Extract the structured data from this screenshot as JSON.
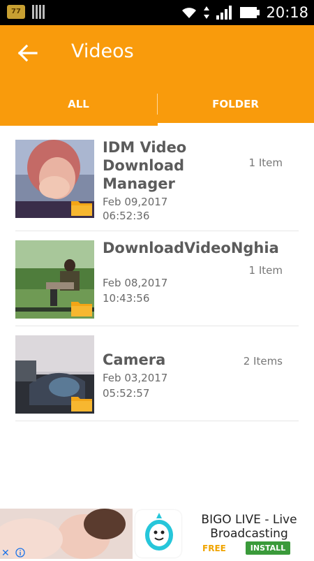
{
  "status_bar": {
    "notification_icon_text": "77",
    "time": "20:18",
    "icons": [
      "sim-icon",
      "wifi-icon",
      "data-arrows-icon",
      "signal-icon",
      "battery-icon"
    ]
  },
  "app_bar": {
    "title": "Videos",
    "back_icon": "arrow-left-icon",
    "color": "#f99b0c"
  },
  "tabs": [
    {
      "label": "ALL",
      "selected": false
    },
    {
      "label": "FOLDER",
      "selected": true
    }
  ],
  "folders": [
    {
      "name": "IDM Video Download Manager",
      "date": "Feb 09,2017",
      "time": "06:52:36",
      "count": "1 Item"
    },
    {
      "name": "DownloadVideoNghia",
      "date": "Feb 08,2017",
      "time": "10:43:56",
      "count": "1 Item"
    },
    {
      "name": "Camera",
      "date": "Feb 03,2017",
      "time": "05:52:57",
      "count": "2 Items"
    }
  ],
  "ad": {
    "title": "BIGO LIVE - Live Broadcasting",
    "price": "FREE",
    "install_label": "INSTALL",
    "close_icon": "close-icon",
    "info_icon": "info-icon"
  }
}
